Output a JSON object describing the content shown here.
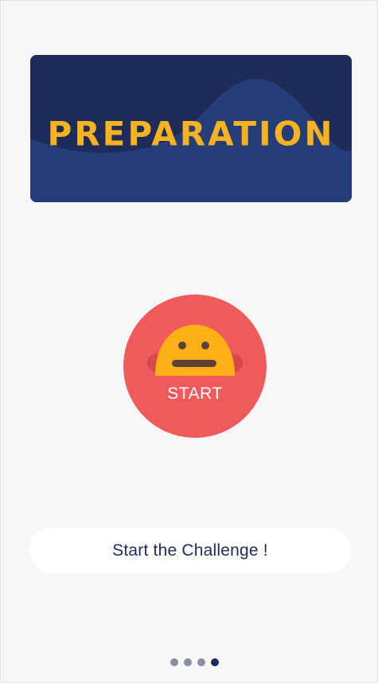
{
  "banner": {
    "title": "PREPARATION"
  },
  "start_button": {
    "label": "START"
  },
  "cta": {
    "label": "Start the Challenge !"
  },
  "pagination": {
    "total": 4,
    "active_index": 3
  },
  "colors": {
    "banner_dark": "#1f2b58",
    "banner_wave": "#243d7a",
    "title_yellow": "#f5b321",
    "start_red": "#f15a5a",
    "face_yellow": "#fbb116",
    "text_navy": "#1f2b58",
    "dot_inactive": "#8a8ea5"
  }
}
